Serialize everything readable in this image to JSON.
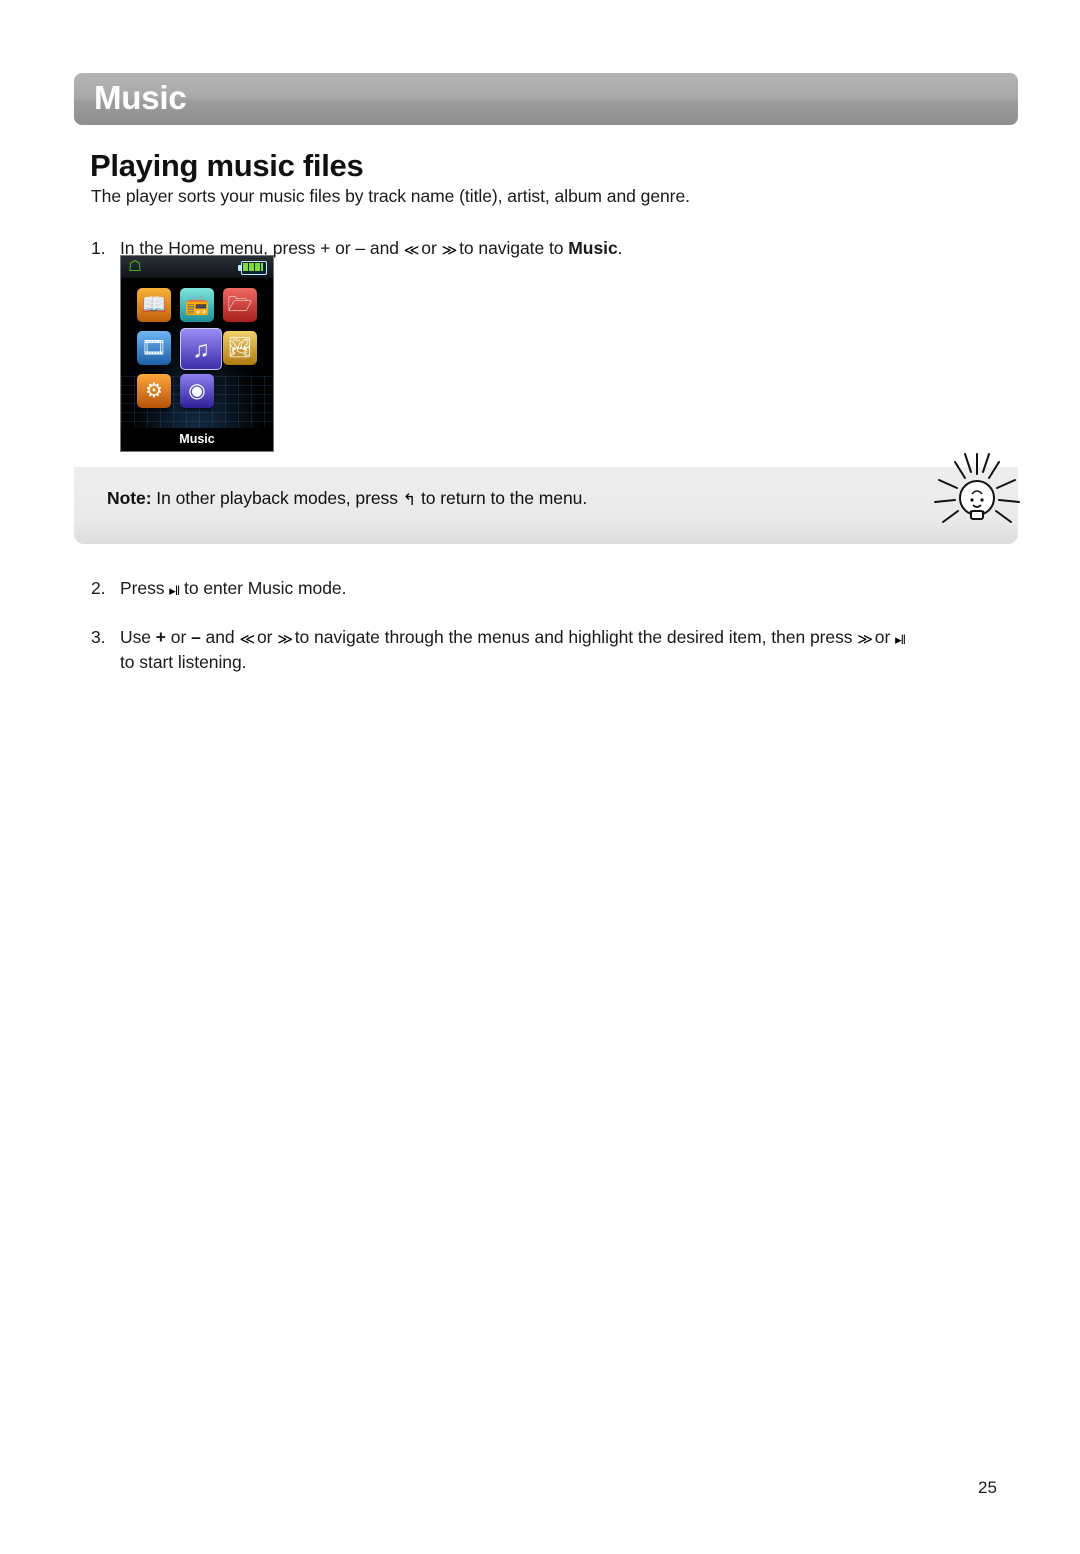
{
  "header": {
    "title": "Music"
  },
  "section": {
    "title": "Playing music files",
    "intro": "The player sorts your music files by track name (title), artist, album and genre."
  },
  "steps": [
    {
      "number": "1.",
      "text_before": "In the Home menu, press + or – and ",
      "key_prev": "≪",
      "mid1": " or ",
      "key_next": "≫",
      "mid2": " to navigate to ",
      "bold": "Music",
      "text_after": "."
    },
    {
      "number": "2.",
      "text_before": "Press ",
      "key_playpause": "▸‖",
      "text_after": " to enter Music mode."
    },
    {
      "number": "3.",
      "text_before": "Use ",
      "plus": "+",
      "mid1": " or ",
      "minus": "–",
      "mid2": " and ",
      "key_prev": "≪",
      "mid3": " or ",
      "key_next": "≫",
      "mid4": " to navigate through the menus and highlight the desired item, then press ",
      "key_next2": "≫",
      "mid5": " or ",
      "key_playpause": "▸‖",
      "line2": "to start listening."
    }
  ],
  "note": {
    "label": "Note:",
    "text_before": " In other playback modes, press ",
    "key_return": "↰",
    "text_after": " to return to the menu."
  },
  "device": {
    "status_home_icon": "home-icon",
    "status_battery_icon": "battery-icon",
    "selected_label": "Music",
    "icons": [
      {
        "name": "ebook-icon",
        "glyph": "📖"
      },
      {
        "name": "radio-icon",
        "glyph": "📻"
      },
      {
        "name": "folder-icon",
        "glyph": "🗂"
      },
      {
        "name": "video-icon",
        "glyph": "🎞"
      },
      {
        "name": "music-icon",
        "glyph": "♫"
      },
      {
        "name": "photo-icon",
        "glyph": "🏞"
      },
      {
        "name": "settings-icon",
        "glyph": "⚙"
      },
      {
        "name": "record-icon",
        "glyph": "◉"
      }
    ]
  },
  "footer": {
    "page_number": "25"
  },
  "colors": {
    "header_bar": "#a0a0a0",
    "note_box": "#e9e9e9",
    "music_tile": "#3b2ea8"
  }
}
